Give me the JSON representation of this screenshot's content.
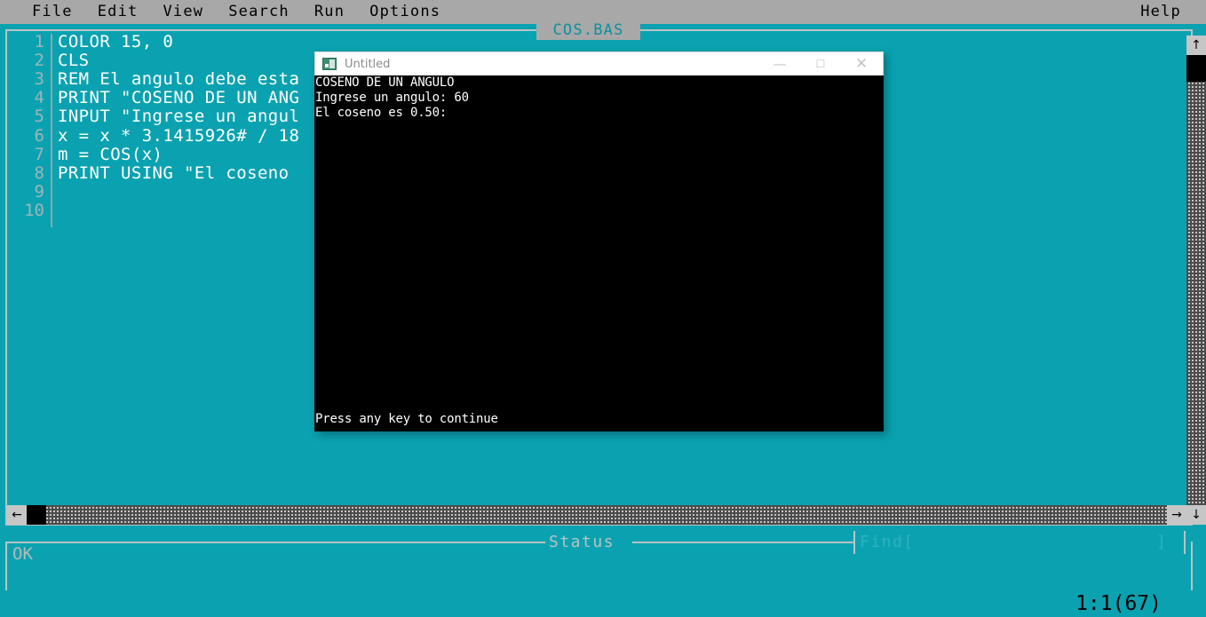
{
  "menu": {
    "left_items": [
      "File",
      "Edit",
      "View",
      "Search",
      "Run",
      "Options"
    ],
    "help_label": "Help"
  },
  "editor": {
    "file_tab": "COS.BAS",
    "lines": [
      {
        "number": "1",
        "text": "COLOR 15, 0"
      },
      {
        "number": "2",
        "text": "CLS"
      },
      {
        "number": "3",
        "text": "REM El angulo debe esta"
      },
      {
        "number": "4",
        "text": "PRINT \"COSENO DE UN ANG"
      },
      {
        "number": "5",
        "text": "INPUT \"Ingrese un angul"
      },
      {
        "number": "6",
        "text": "x = x * 3.1415926# / 18"
      },
      {
        "number": "7",
        "text": "m = COS(x)"
      },
      {
        "number": "8",
        "text": "PRINT USING \"El coseno"
      },
      {
        "number": "9",
        "text": ""
      },
      {
        "number": "10",
        "text": ""
      }
    ]
  },
  "scrollbars": {
    "h_left_arrow": "←",
    "h_right_arrow": "→",
    "v_up_arrow": "↑",
    "v_down_arrow": "↓"
  },
  "status": {
    "legend": "Status",
    "message": "OK",
    "find_label": "Find[",
    "find_close": "]"
  },
  "bottom": {
    "cursor_position": "1:1(67)"
  },
  "console": {
    "title": "Untitled",
    "icon": "console-icon",
    "minimize": "—",
    "maximize": "☐",
    "close": "✕",
    "output_lines": [
      "COSENO DE UN ANGULO",
      "Ingrese un angulo: 60",
      "El coseno es 0.50:"
    ],
    "footer": "Press any key to continue"
  },
  "colors": {
    "background_teal": "#0aa2b0",
    "menubar_gray": "#a8a8a8",
    "frame_border": "#b9c3c4",
    "code_white": "#ffffff",
    "linenum_gray": "#9fb5b7",
    "console_black": "#000000",
    "tab_text": "#0d8f9c"
  }
}
